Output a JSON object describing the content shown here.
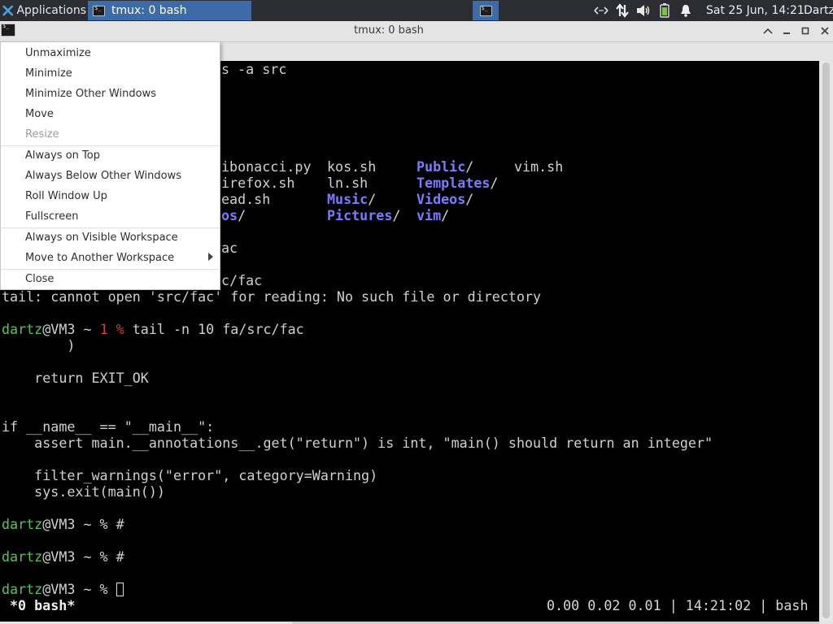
{
  "panel": {
    "applications_label": "Applications",
    "task_title": "tmux: 0 bash",
    "clock": "Sat 25 Jun, 14:21",
    "user": "Dartz",
    "tray_icons": [
      "network-arrows-icon",
      "transfer-icon",
      "volume-icon",
      "battery-icon",
      "bell-icon"
    ]
  },
  "window": {
    "title": "tmux: 0 bash",
    "buttons": [
      "shade-up-icon",
      "minimize-icon",
      "maximize-icon",
      "close-icon"
    ]
  },
  "menu": {
    "items": [
      {
        "label": "Unmaximize",
        "enabled": true
      },
      {
        "label": "Minimize",
        "enabled": true
      },
      {
        "label": "Minimize Other Windows",
        "enabled": true
      },
      {
        "label": "Move",
        "enabled": true
      },
      {
        "label": "Resize",
        "enabled": false
      },
      {
        "label": "Always on Top",
        "enabled": true
      },
      {
        "label": "Always Below Other Windows",
        "enabled": true
      },
      {
        "label": "Roll Window Up",
        "enabled": true
      },
      {
        "label": "Fullscreen",
        "enabled": true
      },
      {
        "label": "Always on Visible Workspace",
        "enabled": true
      },
      {
        "label": "Move to Another Workspace",
        "enabled": true,
        "submenu": true
      },
      {
        "label": "Close",
        "enabled": true
      }
    ]
  },
  "terminal": {
    "prompt_user": "dartz",
    "prompt_host": "@VM3",
    "l0": "s -a src",
    "ls_row1": {
      "c1": "ibonacci.py",
      "c2": "kos.sh",
      "c3": "Public",
      "c4": "vim.sh"
    },
    "ls_row2": {
      "c1": "irefox.sh",
      "c2": "ln.sh",
      "c3": "Templates"
    },
    "ls_row3": {
      "c1": "ead.sh",
      "c2": "Music",
      "c3": "Videos"
    },
    "ls_row4": {
      "c1": "os",
      "c2": "Pictures",
      "c3": "vim"
    },
    "l_fac1": "ac",
    "l_fac2": "c/fac",
    "error_line": "tail: cannot open 'src/fac' for reading: No such file or directory",
    "prompt_tilde": " ~ ",
    "exit_status": "1 %",
    "tail_cmd": " tail -n 10 fa/src/fac",
    "code": [
      "        )",
      "",
      "    return EXIT_OK",
      "",
      "",
      "if __name__ == \"__main__\":",
      "    assert main.__annotations__.get(\"return\") is int, \"main() should return an integer\"",
      "",
      "    filter_warnings(\"error\", category=Warning)",
      "    sys.exit(main())"
    ],
    "prompt_tail": " ~ % #",
    "prompt_last": " ~ % "
  },
  "tmux_status": {
    "left": "*0 bash*",
    "right": "0.00 0.02 0.01 | 14:21:02 | bash"
  }
}
